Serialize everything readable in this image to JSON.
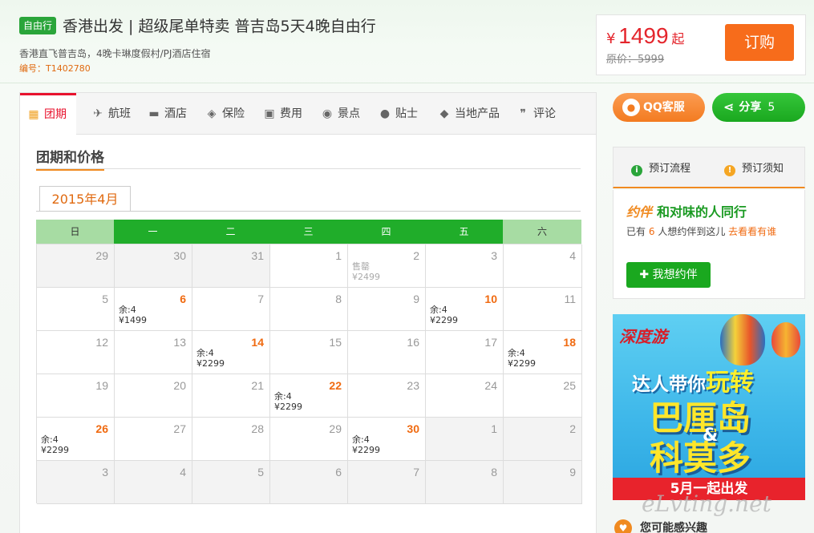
{
  "header": {
    "badge": "自由行",
    "title": "香港出发 | 超级尾单特卖 普吉岛5天4晚自由行",
    "subtitle": "香港直飞普吉岛，4晚卡琳度假村/PJ酒店住宿",
    "code_label": "编号：",
    "code": "T1402780",
    "price_symbol": "¥",
    "price": "1499",
    "price_suffix": "起",
    "original_price": "原价：5999",
    "order_label": "订购"
  },
  "tabs": [
    {
      "label": "团期",
      "icon": "calendar-icon",
      "glyph": "▦",
      "active": true
    },
    {
      "label": "航班",
      "icon": "plane-icon",
      "glyph": "✈"
    },
    {
      "label": "酒店",
      "icon": "bed-icon",
      "glyph": "▬"
    },
    {
      "label": "保险",
      "icon": "shield-icon",
      "glyph": "◈"
    },
    {
      "label": "费用",
      "icon": "wallet-icon",
      "glyph": "▣"
    },
    {
      "label": "景点",
      "icon": "location-pin-icon",
      "glyph": "◉"
    },
    {
      "label": "贴士",
      "icon": "tips-bubble-icon",
      "glyph": "●"
    },
    {
      "label": "当地产品",
      "icon": "local-product-icon",
      "glyph": "◆"
    },
    {
      "label": "评论",
      "icon": "quote-icon",
      "glyph": "❞"
    }
  ],
  "section": {
    "title": "团期和价格",
    "month": "2015年4月"
  },
  "calendar": {
    "weekdays": [
      "日",
      "一",
      "二",
      "三",
      "四",
      "五",
      "六"
    ],
    "weeks": [
      [
        {
          "day": "29",
          "type": "other"
        },
        {
          "day": "30",
          "type": "other"
        },
        {
          "day": "31",
          "type": "other"
        },
        {
          "day": "1"
        },
        {
          "day": "2",
          "type": "sold",
          "line1": "售罄",
          "line2": "¥2499"
        },
        {
          "day": "3"
        },
        {
          "day": "4"
        }
      ],
      [
        {
          "day": "5"
        },
        {
          "day": "6",
          "type": "avail",
          "line1": "余:4",
          "line2": "¥1499"
        },
        {
          "day": "7"
        },
        {
          "day": "8"
        },
        {
          "day": "9"
        },
        {
          "day": "10",
          "type": "avail",
          "line1": "余:4",
          "line2": "¥2299"
        },
        {
          "day": "11"
        }
      ],
      [
        {
          "day": "12"
        },
        {
          "day": "13"
        },
        {
          "day": "14",
          "type": "avail",
          "line1": "余:4",
          "line2": "¥2299"
        },
        {
          "day": "15"
        },
        {
          "day": "16"
        },
        {
          "day": "17"
        },
        {
          "day": "18",
          "type": "avail",
          "line1": "余:4",
          "line2": "¥2299"
        }
      ],
      [
        {
          "day": "19"
        },
        {
          "day": "20"
        },
        {
          "day": "21"
        },
        {
          "day": "22",
          "type": "avail",
          "line1": "余:4",
          "line2": "¥2299"
        },
        {
          "day": "23"
        },
        {
          "day": "24"
        },
        {
          "day": "25"
        }
      ],
      [
        {
          "day": "26",
          "type": "avail",
          "line1": "余:4",
          "line2": "¥2299"
        },
        {
          "day": "27"
        },
        {
          "day": "28"
        },
        {
          "day": "29"
        },
        {
          "day": "30",
          "type": "avail",
          "line1": "余:4",
          "line2": "¥2299"
        },
        {
          "day": "1",
          "type": "other"
        },
        {
          "day": "2",
          "type": "other"
        }
      ],
      [
        {
          "day": "3",
          "type": "other"
        },
        {
          "day": "4",
          "type": "other"
        },
        {
          "day": "5",
          "type": "other"
        },
        {
          "day": "6",
          "type": "other"
        },
        {
          "day": "7",
          "type": "other"
        },
        {
          "day": "8",
          "type": "other"
        },
        {
          "day": "9",
          "type": "other"
        }
      ]
    ]
  },
  "sidebar": {
    "qq_label": "QQ客服",
    "share_label": "分享",
    "share_count": "5",
    "process_label": "预订流程",
    "notice_label": "预订须知",
    "companion_logo": "约伴",
    "companion_title": "和对味的人同行",
    "companion_prefix": "已有",
    "companion_count": "6",
    "companion_middle": "人想约伴到这儿",
    "companion_link": "去看看有谁",
    "want_label": "我想约伴",
    "ad": {
      "brand": "深度游",
      "slogan_a": "达人带你",
      "slogan_b": "玩转",
      "dest1": "巴厘岛",
      "amp": "&",
      "dest2": "科莫多",
      "bar": "5月一起出发"
    },
    "watermark": "eLvting.net",
    "interest_label": "您可能感兴趣"
  },
  "colors": {
    "brand_green": "#20ad2a",
    "accent_orange": "#f76c1b",
    "price_red": "#e4252c"
  }
}
